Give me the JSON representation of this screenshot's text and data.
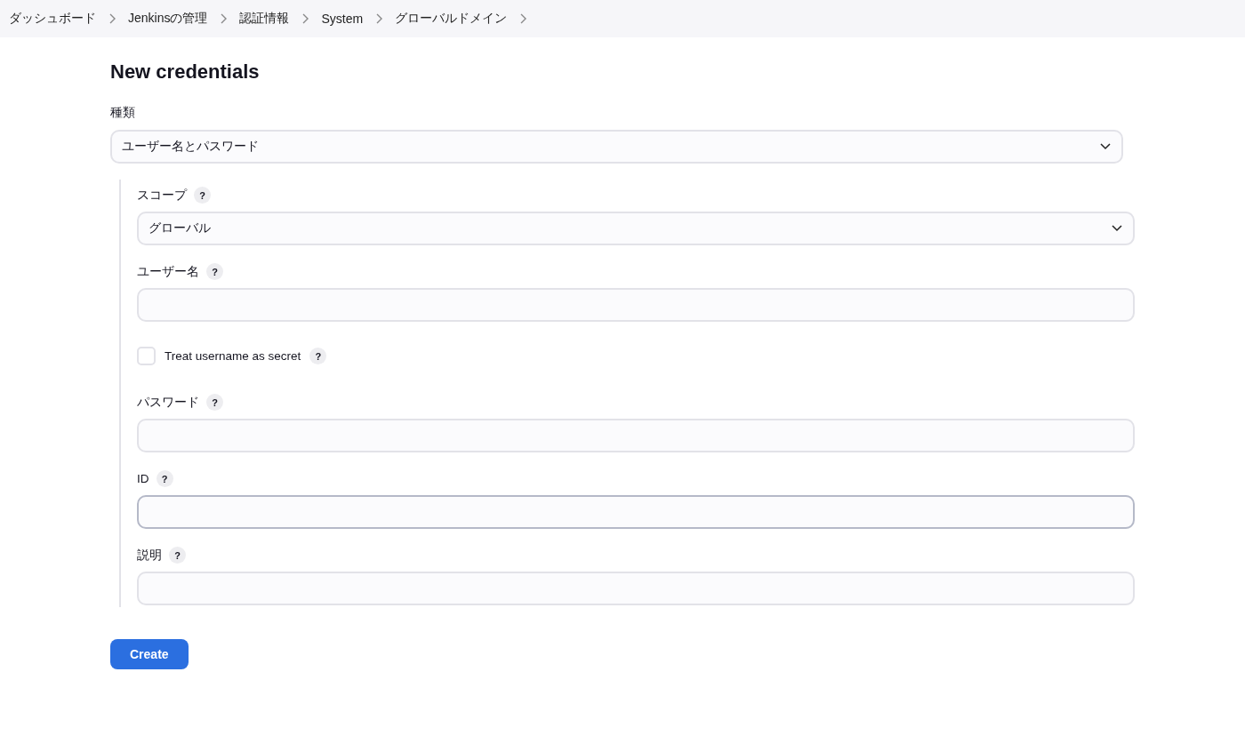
{
  "breadcrumbs": [
    "ダッシュボード",
    "Jenkinsの管理",
    "認証情報",
    "System",
    "グローバルドメイン"
  ],
  "title": "New credentials",
  "kind_field": {
    "label": "種類",
    "value": "ユーザー名とパスワード"
  },
  "fields": [
    {
      "kind": "select",
      "label": "スコープ",
      "help": "?",
      "value": "グローバル"
    },
    {
      "kind": "text",
      "label": "ユーザー名",
      "help": "?",
      "focused": false
    },
    {
      "kind": "checkbox",
      "label": "Treat username as secret",
      "help": "?",
      "checked": false
    },
    {
      "kind": "text",
      "label": "パスワード",
      "help": "?",
      "focused": false
    },
    {
      "kind": "text",
      "label": "ID",
      "help": "?",
      "focused": true
    },
    {
      "kind": "text",
      "label": "説明",
      "help": "?",
      "focused": false
    }
  ],
  "button": "Create"
}
